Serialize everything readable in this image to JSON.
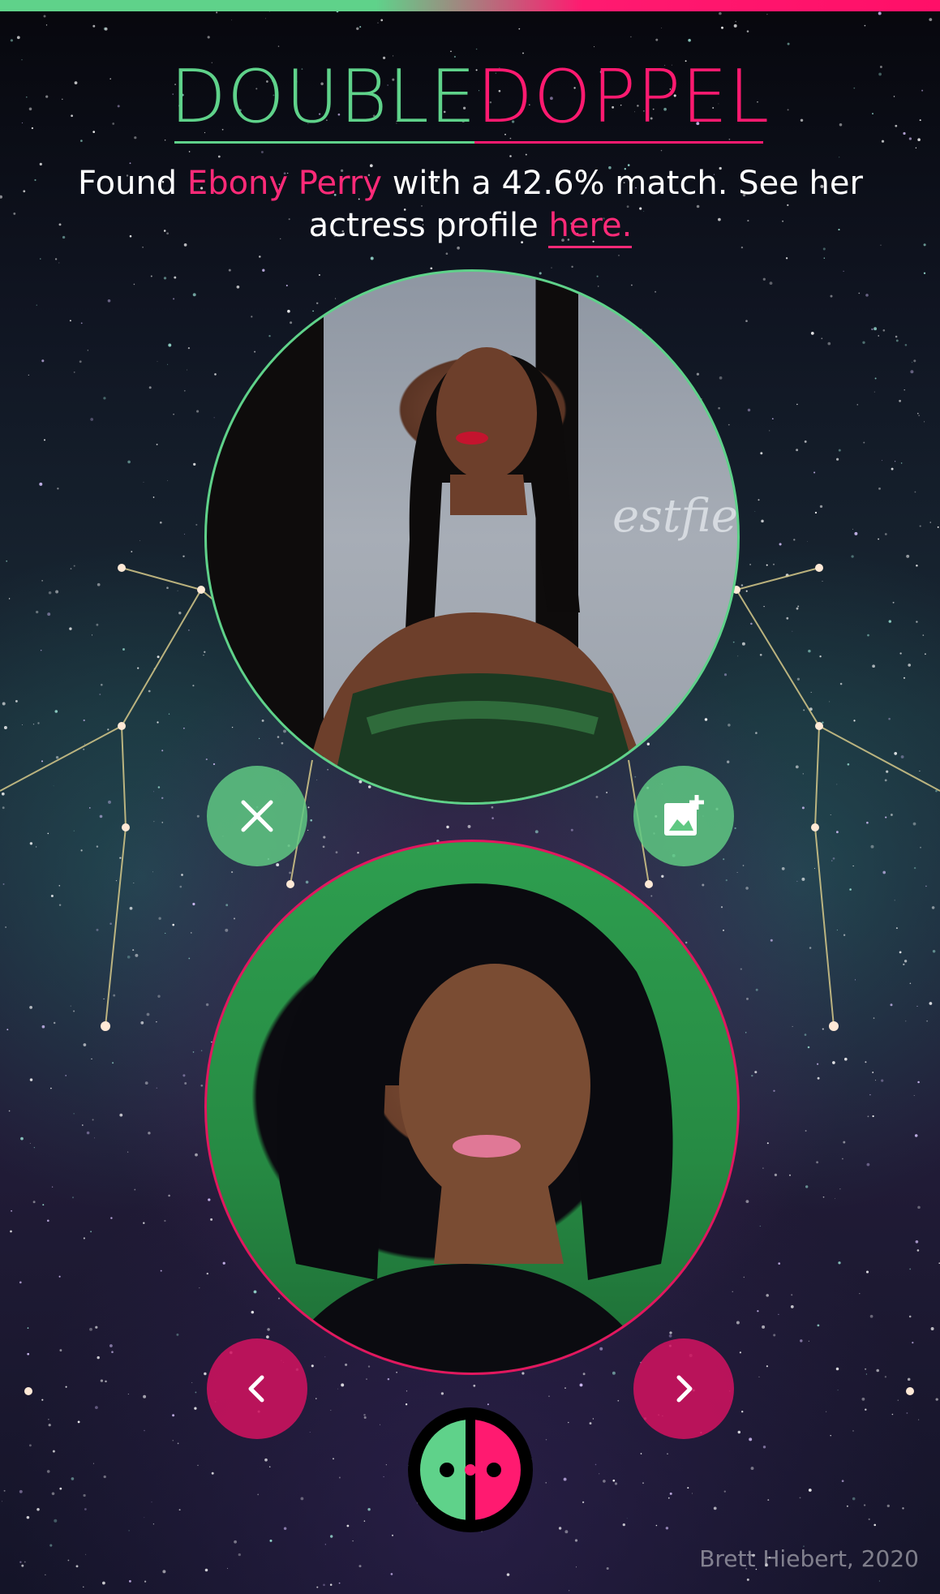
{
  "app": {
    "logo_part1": "DOUBLE",
    "logo_part2": "DOPPEL"
  },
  "result": {
    "found_prefix": "Found",
    "actress_name": "Ebony Perry",
    "match_text": "with a 42.6% match. See her actress profile",
    "link_text": "here."
  },
  "photos": {
    "uploaded_icon": "user-photo",
    "match_icon": "actress-photo"
  },
  "buttons": {
    "close_icon": "close-icon",
    "add_image_icon": "add-photo-icon",
    "prev_icon": "chevron-left-icon",
    "next_icon": "chevron-right-icon"
  },
  "footer": {
    "credit": "Brett Hiebert, 2020"
  },
  "colors": {
    "accent_green": "#5fd28a",
    "accent_pink": "#ff1a70"
  }
}
